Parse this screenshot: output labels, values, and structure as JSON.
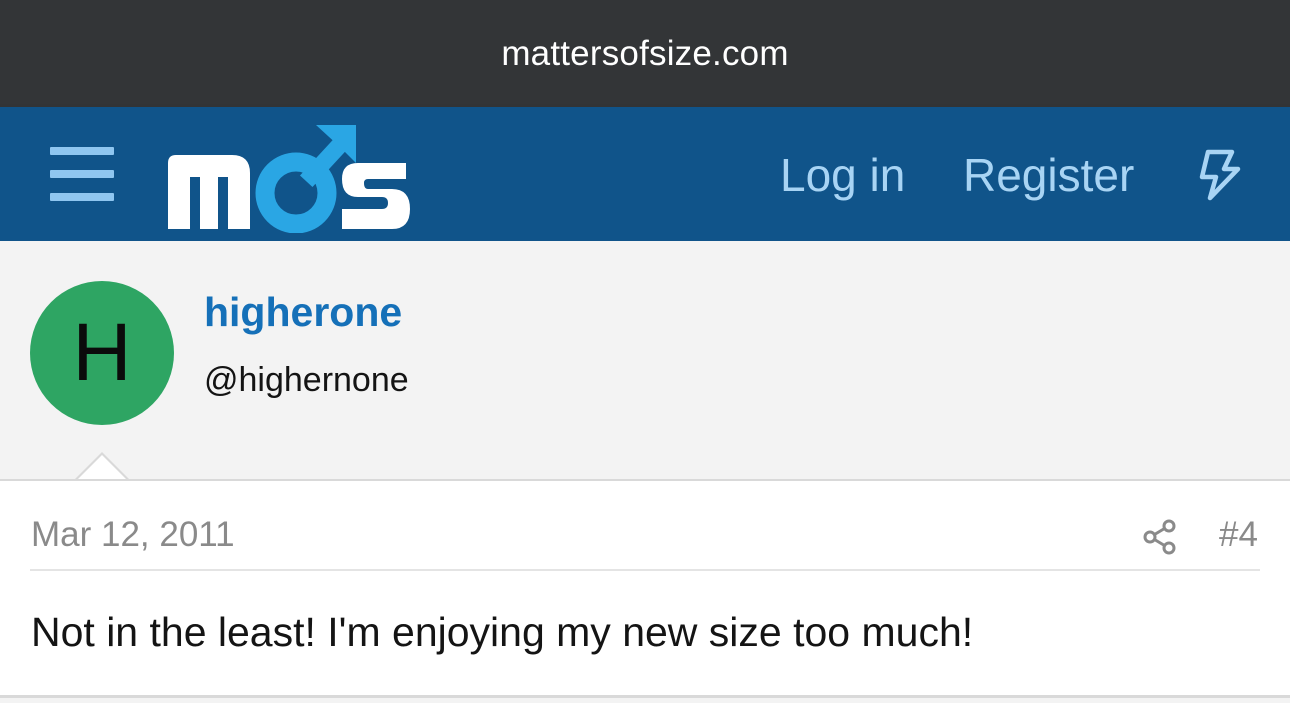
{
  "browser": {
    "url": "mattersofsize.com"
  },
  "header": {
    "logo_text": "mos",
    "nav": {
      "login_label": "Log in",
      "register_label": "Register"
    },
    "menu_icon": "hamburger-menu-icon",
    "whats_new_icon": "bolt-icon"
  },
  "post": {
    "author": {
      "avatar_letter": "H",
      "avatar_color": "#2ea563",
      "username": "higherone",
      "handle": "@highernone"
    },
    "date": "Mar 12, 2011",
    "share_icon": "share-icon",
    "number": "#4",
    "body": "Not in the least! I'm enjoying my new size too much!"
  },
  "colors": {
    "url_bar": "#333537",
    "header_bg": "#10548a",
    "nav_text": "#a8d4f4",
    "logo_accent": "#2aa6e4",
    "username": "#1570b8"
  }
}
